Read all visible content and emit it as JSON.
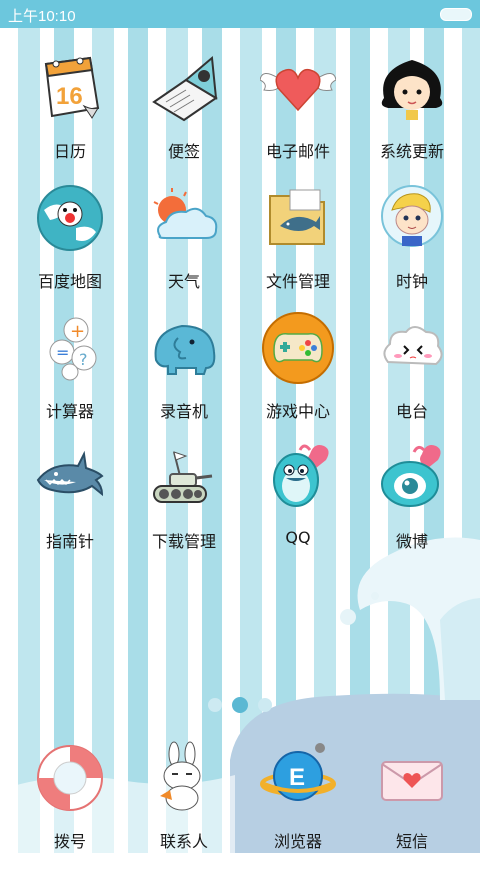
{
  "status": {
    "time": "上午10:10"
  },
  "apps": [
    {
      "label": "日历",
      "icon": "calendar-icon"
    },
    {
      "label": "便签",
      "icon": "notepad-icon"
    },
    {
      "label": "电子邮件",
      "icon": "winged-heart-icon"
    },
    {
      "label": "系统更新",
      "icon": "girl-face-icon"
    },
    {
      "label": "百度地图",
      "icon": "globe-face-icon"
    },
    {
      "label": "天气",
      "icon": "sun-cloud-icon"
    },
    {
      "label": "文件管理",
      "icon": "folder-shark-icon"
    },
    {
      "label": "时钟",
      "icon": "boy-bubble-icon"
    },
    {
      "label": "计算器",
      "icon": "calculator-bubbles-icon"
    },
    {
      "label": "录音机",
      "icon": "elephant-icon"
    },
    {
      "label": "游戏中心",
      "icon": "gamepad-icon"
    },
    {
      "label": "电台",
      "icon": "cloud-face-icon"
    },
    {
      "label": "指南针",
      "icon": "shark-icon"
    },
    {
      "label": "下载管理",
      "icon": "tank-icon"
    },
    {
      "label": "QQ",
      "icon": "penguin-heart-icon"
    },
    {
      "label": "微博",
      "icon": "weibo-eye-icon"
    }
  ],
  "page_indicator": {
    "pages": 3,
    "current": 2
  },
  "dock": [
    {
      "label": "拨号",
      "icon": "lifebuoy-icon"
    },
    {
      "label": "联系人",
      "icon": "bunny-icon"
    },
    {
      "label": "浏览器",
      "icon": "planet-e-icon"
    },
    {
      "label": "短信",
      "icon": "envelope-heart-icon"
    }
  ]
}
